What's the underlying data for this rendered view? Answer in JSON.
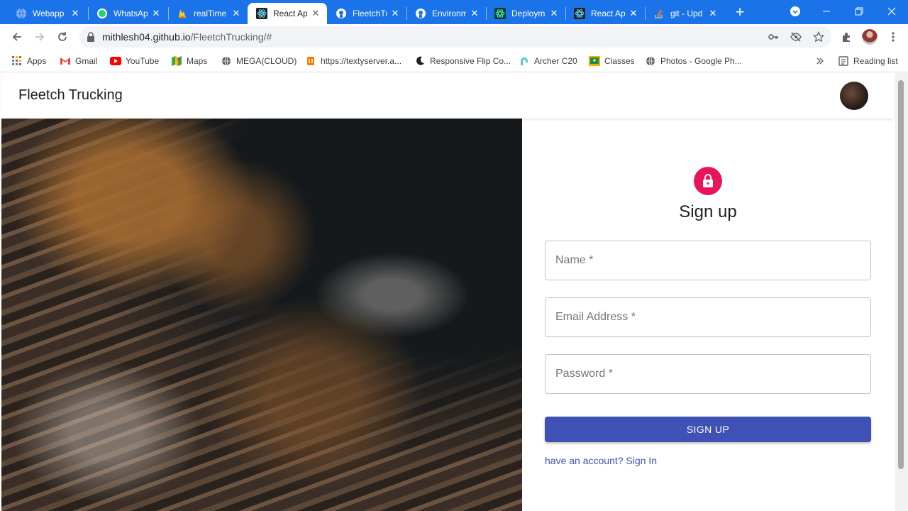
{
  "browser": {
    "tabs": [
      {
        "title": "Webapp",
        "icon": "globe-icon",
        "active": false
      },
      {
        "title": "WhatsApp",
        "icon": "whatsapp-icon",
        "active": false
      },
      {
        "title": "realTime",
        "icon": "firebase-icon",
        "active": false
      },
      {
        "title": "React App",
        "icon": "react-icon",
        "active": true
      },
      {
        "title": "FleetchTr",
        "icon": "github-icon",
        "active": false
      },
      {
        "title": "Environm",
        "icon": "github-icon",
        "active": false
      },
      {
        "title": "Deploym",
        "icon": "react-icon",
        "active": false
      },
      {
        "title": "React Ap",
        "icon": "react-icon",
        "active": false
      },
      {
        "title": "git - Upd",
        "icon": "stackoverflow-icon",
        "active": false
      }
    ],
    "url_host": "mithlesh04.github.io",
    "url_path": "/FleetchTrucking/#",
    "bookmarks": [
      {
        "label": "Apps",
        "icon": "apps-grid-icon"
      },
      {
        "label": "Gmail",
        "icon": "gmail-icon"
      },
      {
        "label": "YouTube",
        "icon": "youtube-icon"
      },
      {
        "label": "Maps",
        "icon": "maps-icon"
      },
      {
        "label": "MEGA(CLOUD)",
        "icon": "globe-icon"
      },
      {
        "label": "https://textyserver.a...",
        "icon": "texty-icon"
      },
      {
        "label": "Responsive Flip Co...",
        "icon": "moon-icon"
      },
      {
        "label": "Archer C20",
        "icon": "tplink-icon"
      },
      {
        "label": "Classes",
        "icon": "classroom-icon"
      },
      {
        "label": "Photos - Google Ph...",
        "icon": "globe-icon"
      }
    ],
    "reading_list": "Reading list",
    "accent_color": "#1a73e8"
  },
  "app": {
    "brand": "Fleetch Trucking",
    "form": {
      "title": "Sign up",
      "fields": [
        {
          "placeholder": "Name *"
        },
        {
          "placeholder": "Email Address *"
        },
        {
          "placeholder": "Password *"
        }
      ],
      "submit_label": "SIGN UP",
      "signin_link": "have an account? Sign In"
    },
    "colors": {
      "lock_badge": "#e8145c",
      "primary": "#3f51b5"
    }
  }
}
